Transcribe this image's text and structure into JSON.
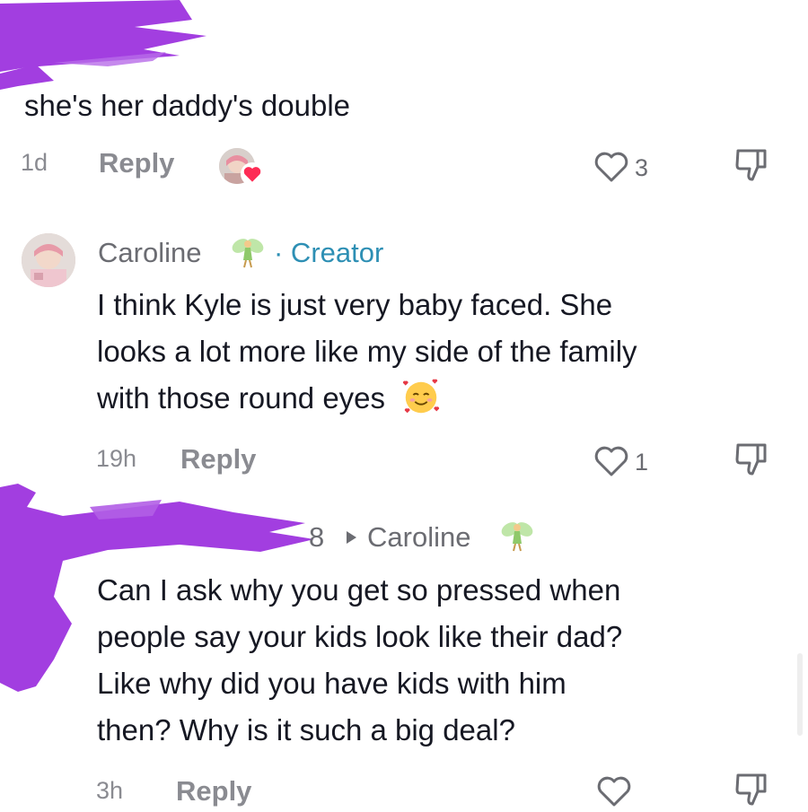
{
  "comments": [
    {
      "username": "",
      "text": "she's her daddy's double",
      "time": "1d",
      "reply_label": "Reply",
      "likes": "3",
      "has_creator_liked": true
    },
    {
      "username": "Caroline",
      "badge": "· Creator",
      "text_lines": [
        "I think Kyle is just very baby faced. She",
        "looks a lot more like my side of the family",
        "with those round eyes"
      ],
      "time": "19h",
      "reply_label": "Reply",
      "likes": "1"
    },
    {
      "username_suffix": "8",
      "reply_to": "Caroline",
      "text_lines": [
        "Can I ask why you get so pressed when",
        "people say your kids look like their dad?",
        "Like why did you have kids with him",
        "then? Why is it such a big deal?"
      ],
      "time": "3h",
      "reply_label": "Reply"
    }
  ],
  "colors": {
    "redaction": "#a23ee0",
    "meta_gray": "#8a8b91",
    "creator_blue": "#2d8fb4",
    "heart_red": "#fe2c55"
  },
  "icons": [
    "heart-outline-icon",
    "dislike-icon",
    "fairy-emoji-icon",
    "smiling-hearts-emoji-icon",
    "play-arrow-icon"
  ]
}
